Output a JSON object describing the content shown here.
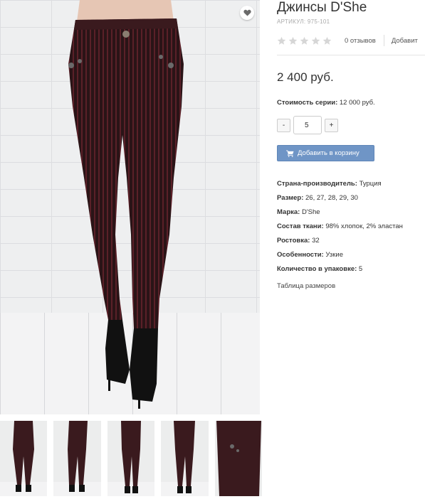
{
  "product": {
    "title": "Джинсы D'She",
    "sku_label": "Артикул:",
    "sku_value": "975-101",
    "reviews": "0 отзывов",
    "add_review": "Добавит",
    "price": "2 400 руб.",
    "series_label": "Стоимость серии:",
    "series_value": "12 000 руб.",
    "qty_minus": "-",
    "qty_value": "5",
    "qty_plus": "+",
    "cart_button": "Добавить в корзину",
    "properties": [
      {
        "label": "Страна-производитель:",
        "value": "Турция"
      },
      {
        "label": "Размер:",
        "value": "26, 27, 28, 29, 30"
      },
      {
        "label": "Марка:",
        "value": "D'She"
      },
      {
        "label": "Состав ткани:",
        "value": "98% хлопок, 2% эластан"
      },
      {
        "label": "Ростовка:",
        "value": "32"
      },
      {
        "label": "Особенности:",
        "value": "Узкие"
      },
      {
        "label": "Количество в упаковке:",
        "value": "5"
      }
    ],
    "size_table_link": "Таблица размеров",
    "rating": 0
  },
  "icons": {
    "favorite": "heart-icon",
    "star": "star-icon",
    "cart": "cart-icon"
  },
  "colors": {
    "button": "#6f95c6",
    "star": "#d6d6d6",
    "jeans": "#3a1a1e"
  }
}
